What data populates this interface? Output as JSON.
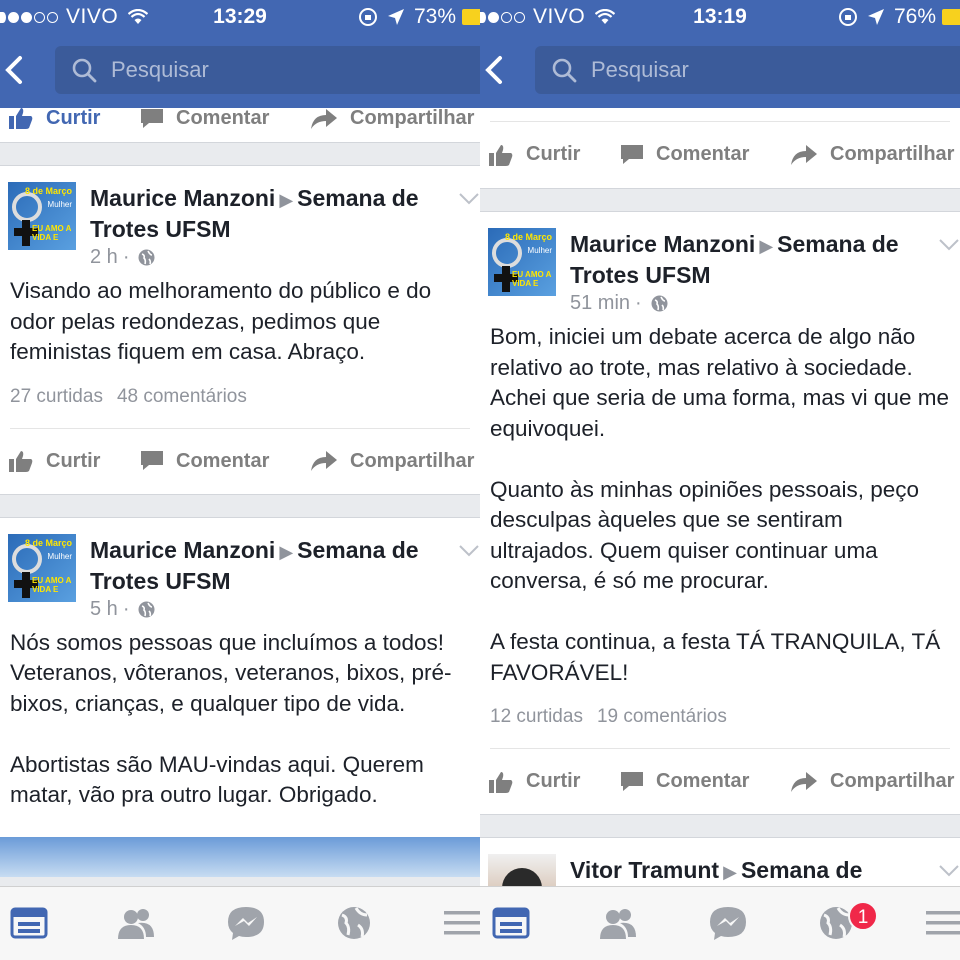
{
  "left": {
    "status": {
      "carrier": "VIVO",
      "time": "13:29",
      "battery": "73%"
    },
    "search": {
      "placeholder": "Pesquisar"
    },
    "top_actions": {
      "like": "Curtir",
      "comment": "Comentar",
      "share": "Compartilhar"
    },
    "posts": [
      {
        "author": "Maurice Manzoni",
        "group": "Semana de Trotes UFSM",
        "time": "2 h",
        "text": "Visando ao melhoramento do público e do odor pelas redondezas, pedimos que feministas fiquem em casa. Abraço.",
        "likes": "27 curtidas",
        "comments": "48 comentários",
        "actions": {
          "like": "Curtir",
          "comment": "Comentar",
          "share": "Compartilhar"
        }
      },
      {
        "author": "Maurice Manzoni",
        "group": "Semana de Trotes UFSM",
        "time": "5 h",
        "text": "Nós somos pessoas que incluímos a todos! Veteranos, vôteranos, veteranos, bixos, pré-bixos, crianças, e qualquer tipo de vida.\n\nAbortistas são MAU-vindas aqui. Querem matar, vão pra outro lugar. Obrigado."
      }
    ]
  },
  "right": {
    "status": {
      "carrier": "VIVO",
      "time": "13:19",
      "battery": "76%"
    },
    "search": {
      "placeholder": "Pesquisar"
    },
    "top_actions": {
      "like": "Curtir",
      "comment": "Comentar",
      "share": "Compartilhar"
    },
    "posts": [
      {
        "author": "Maurice Manzoni",
        "group": "Semana de Trotes UFSM",
        "time": "51 min",
        "text": "Bom, iniciei um debate acerca de algo não relativo ao trote, mas relativo à sociedade. Achei que seria de uma forma, mas vi que me equivoquei.\n\nQuanto às minhas opiniões pessoais, peço desculpas àqueles que se sentiram ultrajados. Quem quiser continuar uma conversa, é só me procurar.\n\nA festa continua, a festa TÁ TRANQUILA, TÁ FAVORÁVEL!",
        "likes": "12 curtidas",
        "comments": "19 comentários",
        "actions": {
          "like": "Curtir",
          "comment": "Comentar",
          "share": "Compartilhar"
        }
      },
      {
        "author": "Vitor Tramunt",
        "group": "Semana de"
      }
    ],
    "notification_badge": "1"
  },
  "avatar_text": {
    "line1": "8 de Março",
    "line2": "Mulher",
    "line3": "EU AMO A VIDA E SOU CONTRA O ABORTO"
  },
  "colors": {
    "header": "#4267b2",
    "search_bg": "#3b5b9a",
    "feed_bg": "#e9ebee",
    "badge": "#f02849",
    "meta_gray": "#90949c",
    "tab_blue": "#4267b2"
  },
  "icons": [
    "back-chevron-icon",
    "search-icon",
    "like-icon",
    "comment-icon",
    "share-icon",
    "globe-icon",
    "chevron-down-icon",
    "news-feed-icon",
    "friends-icon",
    "messenger-icon",
    "notifications-globe-icon",
    "menu-icon"
  ]
}
